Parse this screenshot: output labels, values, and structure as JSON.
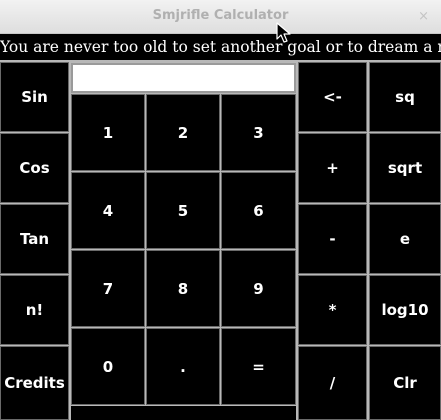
{
  "window": {
    "title": "Smjrifle Calculator",
    "close_glyph": "×"
  },
  "banner": {
    "quote": "You are never too old to set another goal or to dream a new dream"
  },
  "display": {
    "value": ""
  },
  "left_column": {
    "sin": "Sin",
    "cos": "Cos",
    "tan": "Tan",
    "factorial": "n!",
    "credits": "Credits"
  },
  "keypad": {
    "k1": "1",
    "k2": "2",
    "k3": "3",
    "k4": "4",
    "k5": "5",
    "k6": "6",
    "k7": "7",
    "k8": "8",
    "k9": "9",
    "k0": "0",
    "dot": ".",
    "equals": "="
  },
  "operators": {
    "backspace": "<-",
    "plus": "+",
    "minus": "-",
    "multiply": "*",
    "divide": "/"
  },
  "right_column": {
    "square": "sq",
    "sqrt": "sqrt",
    "e": "e",
    "log10": "log10",
    "clear": "Clr"
  }
}
